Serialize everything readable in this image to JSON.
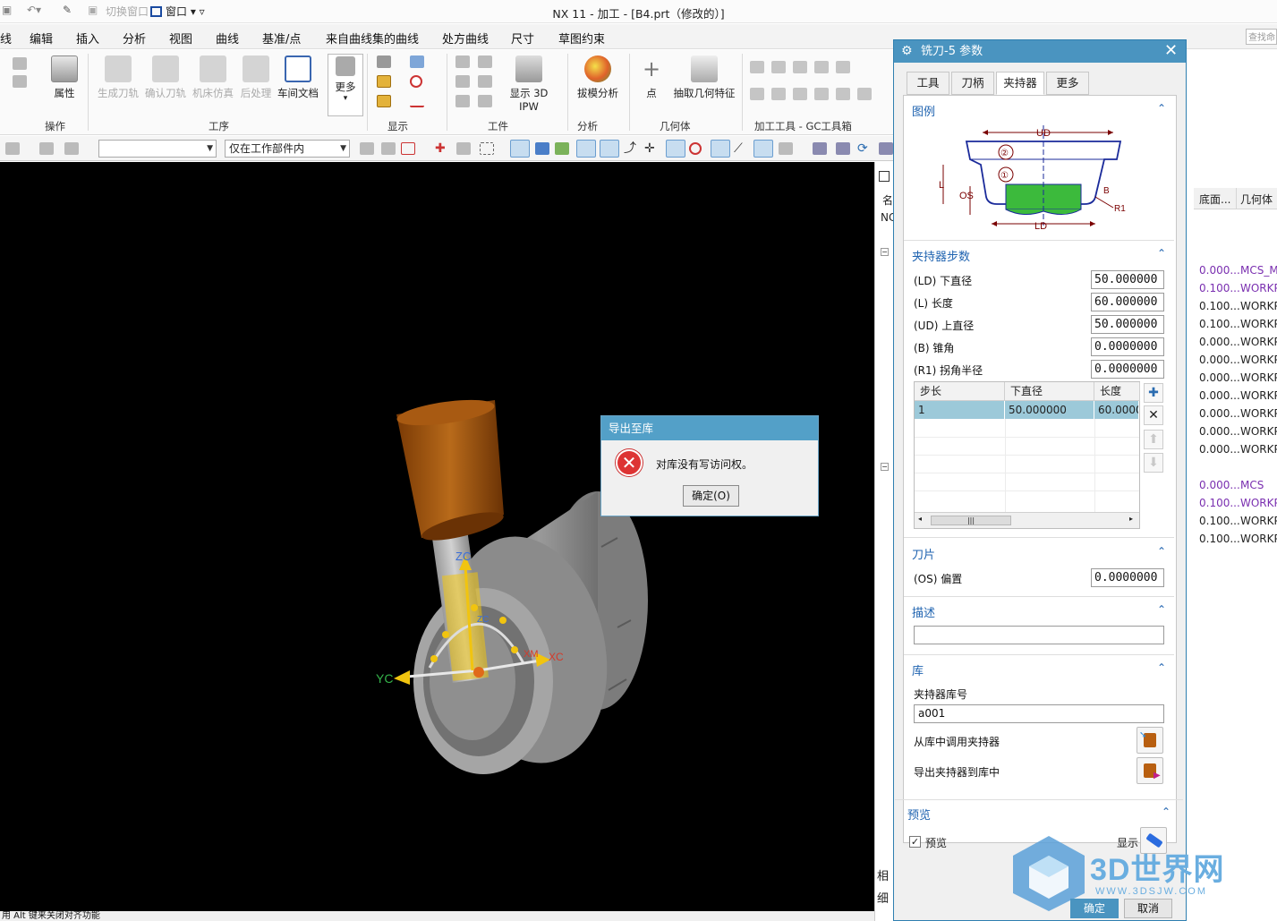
{
  "app": {
    "title": "NX 11 - 加工 - [B4.prt（修改的）]",
    "switch_window": "切换窗口",
    "window_menu": "窗口"
  },
  "menubar": {
    "items": [
      "线",
      "编辑",
      "插入",
      "分析",
      "视图",
      "曲线",
      "基准/点",
      "来自曲线集的曲线",
      "处方曲线",
      "尺寸",
      "草图约束"
    ],
    "search_placeholder": "查找命"
  },
  "ribbon": {
    "buttons": {
      "properties": "属性",
      "generate_path": "生成刀轨",
      "verify_path": "确认刀轨",
      "machine_sim": "机床仿真",
      "postprocess": "后处理",
      "shop_doc": "车间文档",
      "more": "更多",
      "show_3d_ipw": "显示 3D IPW",
      "draft_analysis": "拔模分析",
      "point": "点",
      "extract_geometry": "抽取几何特征"
    },
    "groups": {
      "operation": "操作",
      "procedure": "工序",
      "display": "显示",
      "workpiece": "工件",
      "analysis": "分析",
      "geometry": "几何体",
      "gc_toolbox": "加工工具 - GC工具箱"
    }
  },
  "cmdbar": {
    "filter_value": "",
    "scope_value": "仅在工作部件内"
  },
  "graphics": {
    "axis_labels": {
      "zc_top": "ZC",
      "zc_mid": "ZC",
      "yc": "YC",
      "xm": "XM",
      "xc": "XC"
    }
  },
  "status": {
    "text": "用 Alt 键来关闭对齐功能"
  },
  "navigator": {
    "col_name": "名",
    "nc_label": "NC",
    "col_floor": "底面...",
    "col_geometry": "几何体",
    "rows": [
      {
        "v": "0.000...",
        "g": "MCS_M",
        "p": true
      },
      {
        "v": "0.100...",
        "g": "WORKP",
        "p": true
      },
      {
        "v": "0.100...",
        "g": "WORKP",
        "p": false
      },
      {
        "v": "0.100...",
        "g": "WORKP",
        "p": false
      },
      {
        "v": "0.000...",
        "g": "WORKP",
        "p": false
      },
      {
        "v": "0.000...",
        "g": "WORKP",
        "p": false
      },
      {
        "v": "0.000...",
        "g": "WORKP",
        "p": false
      },
      {
        "v": "0.000...",
        "g": "WORKP",
        "p": false
      },
      {
        "v": "0.000...",
        "g": "WORKP",
        "p": false
      },
      {
        "v": "0.000...",
        "g": "WORKP",
        "p": false
      },
      {
        "v": "0.000...",
        "g": "WORKP",
        "p": false
      },
      {
        "v": "",
        "g": "",
        "p": false
      },
      {
        "v": "0.000...",
        "g": "MCS",
        "p": true
      },
      {
        "v": "0.100...",
        "g": "WORKP",
        "p": true
      },
      {
        "v": "0.100...",
        "g": "WORKP",
        "p": false
      },
      {
        "v": "0.100...",
        "g": "WORKP",
        "p": false
      }
    ],
    "bottom_1": "相",
    "bottom_2": "细"
  },
  "dialog": {
    "title": "铣刀-5 参数",
    "tabs": [
      "工具",
      "刀柄",
      "夹持器",
      "更多"
    ],
    "sections": {
      "figure": "图例",
      "holder_steps": "夹持器步数",
      "insert": "刀片",
      "description": "描述",
      "library": "库",
      "preview": "预览"
    },
    "figure_labels": {
      "ud": "UD",
      "ld": "LD",
      "l": "L",
      "os": "OS",
      "b": "B",
      "r1": "R1",
      "n1": "①",
      "n2": "②"
    },
    "params": [
      {
        "label": "(LD) 下直径",
        "value": "50.000000"
      },
      {
        "label": "(L) 长度",
        "value": "60.000000"
      },
      {
        "label": "(UD) 上直径",
        "value": "50.000000"
      },
      {
        "label": "(B) 锥角",
        "value": "0.0000000"
      },
      {
        "label": "(R1) 拐角半径",
        "value": "0.0000000"
      }
    ],
    "table": {
      "headers": [
        "步长",
        "下直径",
        "长度"
      ],
      "row": [
        "1",
        "50.000000",
        "60.0000"
      ]
    },
    "offset": {
      "label": "(OS) 偏置",
      "value": "0.0000000"
    },
    "description_value": "",
    "library": {
      "number_label": "夹持器库号",
      "number_value": "a001",
      "retrieve": "从库中调用夹持器",
      "export": "导出夹持器到库中"
    },
    "preview": {
      "checkbox_label": "预览",
      "checked": true,
      "show_label": "显示"
    },
    "ok": "确定",
    "cancel": "取消"
  },
  "error_dialog": {
    "title": "导出至库",
    "message": "对库没有写访问权。",
    "ok": "确定(O)"
  },
  "watermark": {
    "brand": "3D世界网",
    "url": "WWW.3DSJW.COM"
  },
  "colors": {
    "accent": "#4a94c0",
    "error": "#d33333",
    "link": "#1f63b0",
    "purple": "#7a2fb0",
    "holder": "#b85f10"
  }
}
